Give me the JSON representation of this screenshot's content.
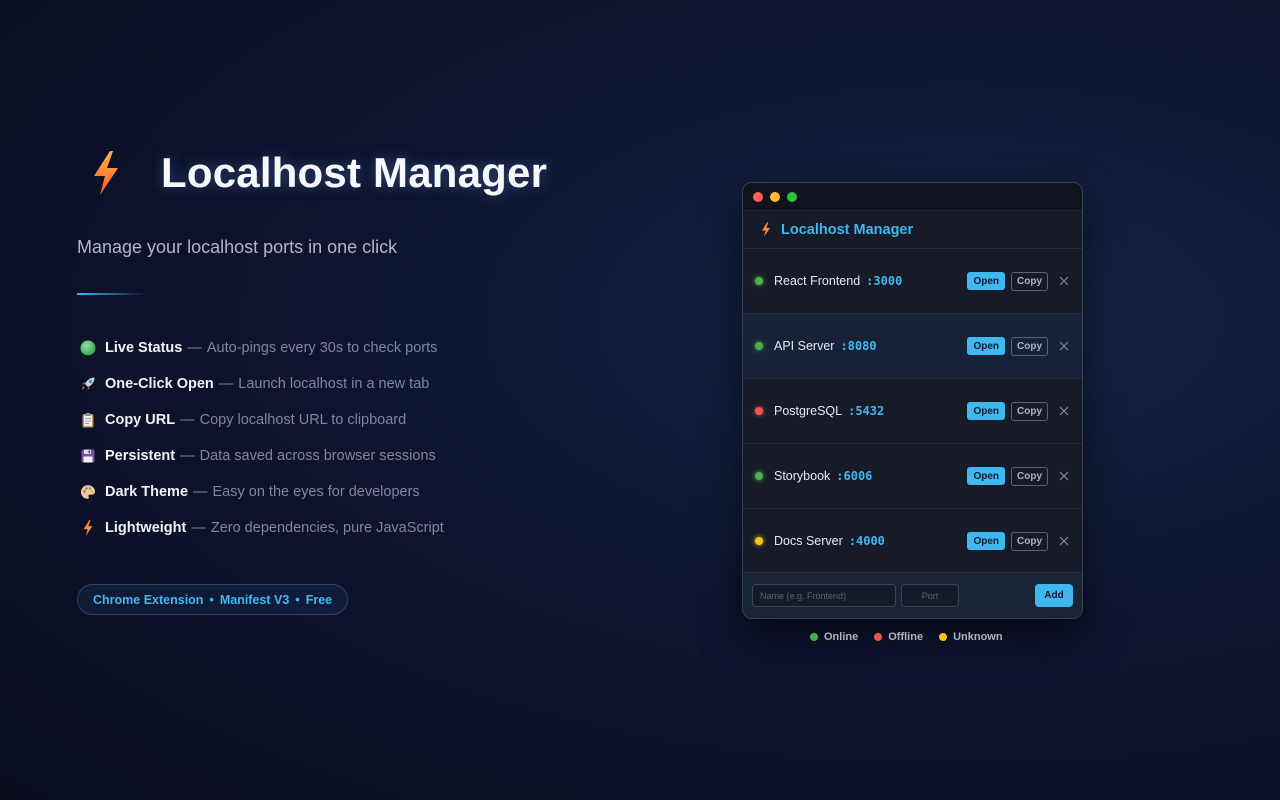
{
  "hero": {
    "title": "Localhost Manager",
    "subtitle": "Manage your localhost ports in one click",
    "features": [
      {
        "icon": "green-circle-icon",
        "name": "Live Status",
        "sep": "—",
        "desc": "Auto-pings every 30s to check ports"
      },
      {
        "icon": "rocket-icon",
        "name": "One-Click Open",
        "sep": "—",
        "desc": "Launch localhost in a new tab"
      },
      {
        "icon": "clipboard-icon",
        "name": "Copy URL",
        "sep": "—",
        "desc": "Copy localhost URL to clipboard"
      },
      {
        "icon": "floppy-disk-icon",
        "name": "Persistent",
        "sep": "—",
        "desc": "Data saved across browser sessions"
      },
      {
        "icon": "palette-icon",
        "name": "Dark Theme",
        "sep": "—",
        "desc": "Easy on the eyes for developers"
      },
      {
        "icon": "lightning-bolt-icon",
        "name": "Lightweight",
        "sep": "—",
        "desc": "Zero dependencies, pure JavaScript"
      }
    ],
    "badge": {
      "part1": "Chrome Extension",
      "sep": "•",
      "part2": "Manifest V3",
      "part3": "Free"
    }
  },
  "popup": {
    "app_title": "Localhost Manager",
    "services": [
      {
        "name": "React Frontend",
        "port": ":3000",
        "status": "online",
        "open_label": "Open",
        "copy_label": "Copy"
      },
      {
        "name": "API Server",
        "port": ":8080",
        "status": "online",
        "open_label": "Open",
        "copy_label": "Copy"
      },
      {
        "name": "PostgreSQL",
        "port": ":5432",
        "status": "offline",
        "open_label": "Open",
        "copy_label": "Copy"
      },
      {
        "name": "Storybook",
        "port": ":6006",
        "status": "online",
        "open_label": "Open",
        "copy_label": "Copy"
      },
      {
        "name": "Docs Server",
        "port": ":4000",
        "status": "unknown",
        "open_label": "Open",
        "copy_label": "Copy"
      }
    ],
    "add_form": {
      "name_placeholder": "Name (e.g. Frontend)",
      "name_value": "",
      "port_placeholder": "Port",
      "port_value": "",
      "add_label": "Add"
    }
  },
  "legend": {
    "online": "Online",
    "offline": "Offline",
    "unknown": "Unknown"
  },
  "colors": {
    "accent": "#3fb8f0",
    "online": "#4caf50",
    "offline": "#ef5350",
    "unknown": "#f5c518",
    "traffic_red": "#ff5f57",
    "traffic_yellow": "#febc2e",
    "traffic_green": "#28c840"
  }
}
